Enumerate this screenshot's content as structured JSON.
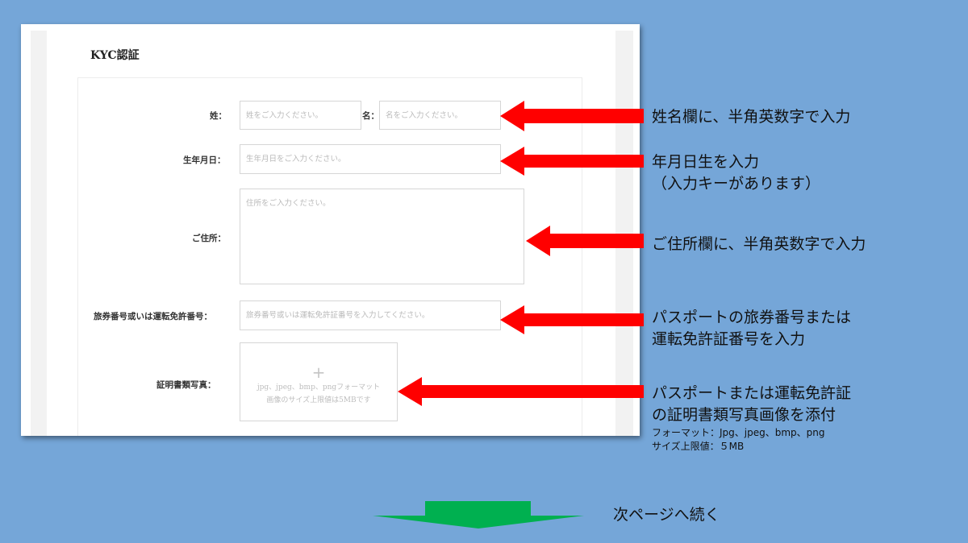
{
  "form": {
    "title": "KYC認証",
    "fields": {
      "last_name": {
        "label": "姓：",
        "placeholder": "姓をご入力ください。",
        "value": ""
      },
      "first_name": {
        "label": "名：",
        "placeholder": "名をご入力ください。",
        "value": ""
      },
      "birthdate": {
        "label": "生年月日：",
        "placeholder": "生年月日をご入力ください。",
        "value": ""
      },
      "address": {
        "label": "ご住所：",
        "placeholder": "住所をご入力ください。",
        "value": ""
      },
      "id_number": {
        "label": "旅券番号或いは運転免許番号：",
        "placeholder": "旅券番号或いは運転免許証番号を入力してください。",
        "value": ""
      },
      "id_photo": {
        "label": "証明書類写真：",
        "plus": "+",
        "hint_line1": "jpg、jpeg、bmp、pngフォーマット",
        "hint_line2": "画像のサイズ上限値は5MBです"
      }
    }
  },
  "annotations": {
    "name": "姓名欄に、半角英数字で入力",
    "birthdate_line1": "年月日生を入力",
    "birthdate_line2": "（入力キーがあります）",
    "address": "ご住所欄に、半角英数字で入力",
    "id_number_line1": "パスポートの旅券番号または",
    "id_number_line2": "運転免許証番号を入力",
    "photo_line1": "パスポートまたは運転免許証",
    "photo_line2": "の証明書類写真画像を添付",
    "photo_format": "フォーマット：Jpg、jpeg、bmp、png",
    "photo_size": "サイズ上限値：５MB"
  },
  "footer": {
    "next_page": "次ページへ続く"
  },
  "colors": {
    "background": "#75a6d8",
    "arrow_red": "#ff0000",
    "arrow_green": "#00b050"
  }
}
